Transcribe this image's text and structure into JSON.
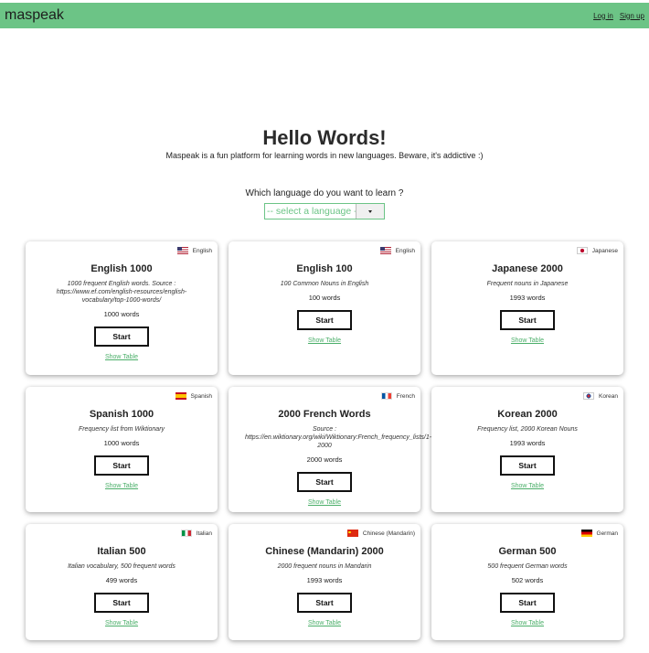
{
  "navbar": {
    "brand": "maspeak",
    "login_label": "Log in",
    "signup_label": "Sign up"
  },
  "hero": {
    "title": "Hello Words!",
    "subtitle": "Maspeak is a fun platform for learning words in new languages. Beware, it's addictive :)",
    "question": "Which language do you want to learn ?",
    "select_value": "-- select a language --"
  },
  "cards": [
    {
      "language": "English",
      "flag_icon": "us-flag-icon",
      "title": "English 1000",
      "description": "1000 frequent English words. Source : https://www.ef.com/english-resources/english-vocabulary/top-1000-words/",
      "count": "1000 words",
      "start_label": "Start",
      "table_label": "Show Table"
    },
    {
      "language": "English",
      "flag_icon": "us-flag-icon",
      "title": "English 100",
      "description": "100 Common Nouns in English",
      "count": "100 words",
      "start_label": "Start",
      "table_label": "Show Table"
    },
    {
      "language": "Japanese",
      "flag_icon": "japan-flag-icon",
      "title": "Japanese 2000",
      "description": "Frequent nouns in Japanese",
      "count": "1993 words",
      "start_label": "Start",
      "table_label": "Show Table"
    },
    {
      "language": "Spanish",
      "flag_icon": "spain-flag-icon",
      "title": "Spanish 1000",
      "description": "Frequency list from Wiktionary",
      "count": "1000 words",
      "start_label": "Start",
      "table_label": "Show Table"
    },
    {
      "language": "French",
      "flag_icon": "france-flag-icon",
      "title": "2000 French Words",
      "description": "Source : https://en.wiktionary.org/wiki/Wiktionary:French_frequency_lists/1-2000",
      "count": "2000 words",
      "start_label": "Start",
      "table_label": "Show Table"
    },
    {
      "language": "Korean",
      "flag_icon": "korea-flag-icon",
      "title": "Korean 2000",
      "description": "Frequency list, 2000 Korean Nouns",
      "count": "1993 words",
      "start_label": "Start",
      "table_label": "Show Table"
    },
    {
      "language": "Italian",
      "flag_icon": "italy-flag-icon",
      "title": "Italian 500",
      "description": "Italian vocabulary, 500 frequent words",
      "count": "499 words",
      "start_label": "Start",
      "table_label": "Show Table"
    },
    {
      "language": "Chinese (Mandarin)",
      "flag_icon": "china-flag-icon",
      "title": "Chinese (Mandarin) 2000",
      "description": "2000 frequent nouns in Mandarin",
      "count": "1993 words",
      "start_label": "Start",
      "table_label": "Show Table"
    },
    {
      "language": "German",
      "flag_icon": "germany-flag-icon",
      "title": "German 500",
      "description": "500 frequent German words",
      "count": "502 words",
      "start_label": "Start",
      "table_label": "Show Table"
    }
  ]
}
